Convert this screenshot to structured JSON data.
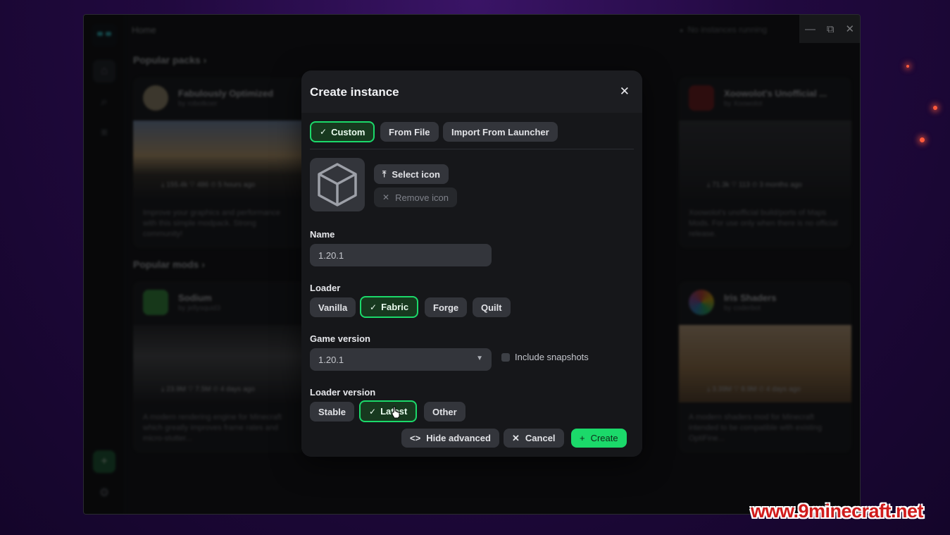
{
  "window": {
    "title": "Home",
    "status": "No instances running",
    "controls": [
      "—",
      "⧉",
      "✕"
    ]
  },
  "background": {
    "popular_packs_title": "Popular packs ›",
    "popular_mods_title": "Popular mods ›",
    "packs": [
      {
        "title": "Fabulously Optimized",
        "by": "by robotkoer",
        "stats": "⤓ 155.4k   ♡ 486   ⏲ 5 hours ago",
        "desc": "Improve your graphics and performance with this simple modpack. Strong community!"
      },
      {
        "title": "Xoowolot's Unofficial ...",
        "by": "by Xoowolot",
        "stats": "⤓ 71.3k   ♡ 113   ⏲ 3 months ago",
        "desc": "Xoowolot's unofficial build/ports of Maps Mods. For use only when there is no official release."
      }
    ],
    "mods": [
      {
        "title": "Sodium",
        "by": "by jellysquid3",
        "stats": "⤓ 23.9M   ♡ 7.5M   ⏲ 4 days ago",
        "desc": "A modern rendering engine for Minecraft which greatly improves frame rates and micro-stutter..."
      },
      {
        "title": "Iris Shaders",
        "by": "by coderbot",
        "stats": "⤓ 3.39M   ♡ 8.9M   ⏲ 4 days ago",
        "desc": "A modern shaders mod for Minecraft intended to be compatible with existing OptiFine..."
      }
    ]
  },
  "modal": {
    "title": "Create instance",
    "tabs": [
      {
        "label": "Custom",
        "selected": true
      },
      {
        "label": "From File",
        "selected": false
      },
      {
        "label": "Import From Launcher",
        "selected": false
      }
    ],
    "select_icon": "Select icon",
    "remove_icon": "Remove icon",
    "name_label": "Name",
    "name_value": "1.20.1",
    "loader_label": "Loader",
    "loaders": [
      {
        "label": "Vanilla",
        "selected": false
      },
      {
        "label": "Fabric",
        "selected": true
      },
      {
        "label": "Forge",
        "selected": false
      },
      {
        "label": "Quilt",
        "selected": false
      }
    ],
    "game_version_label": "Game version",
    "game_version_value": "1.20.1",
    "include_snapshots": "Include snapshots",
    "loader_version_label": "Loader version",
    "loader_versions": [
      {
        "label": "Stable",
        "selected": false
      },
      {
        "label": "Latest",
        "selected": true
      },
      {
        "label": "Other",
        "selected": false
      }
    ],
    "hide_advanced": "Hide advanced",
    "cancel": "Cancel",
    "create": "Create"
  },
  "watermark": "www.9minecraft.net",
  "colors": {
    "accent": "#1bd96a",
    "modal_bg": "#1c1d21",
    "chip_bg": "#33353b"
  }
}
